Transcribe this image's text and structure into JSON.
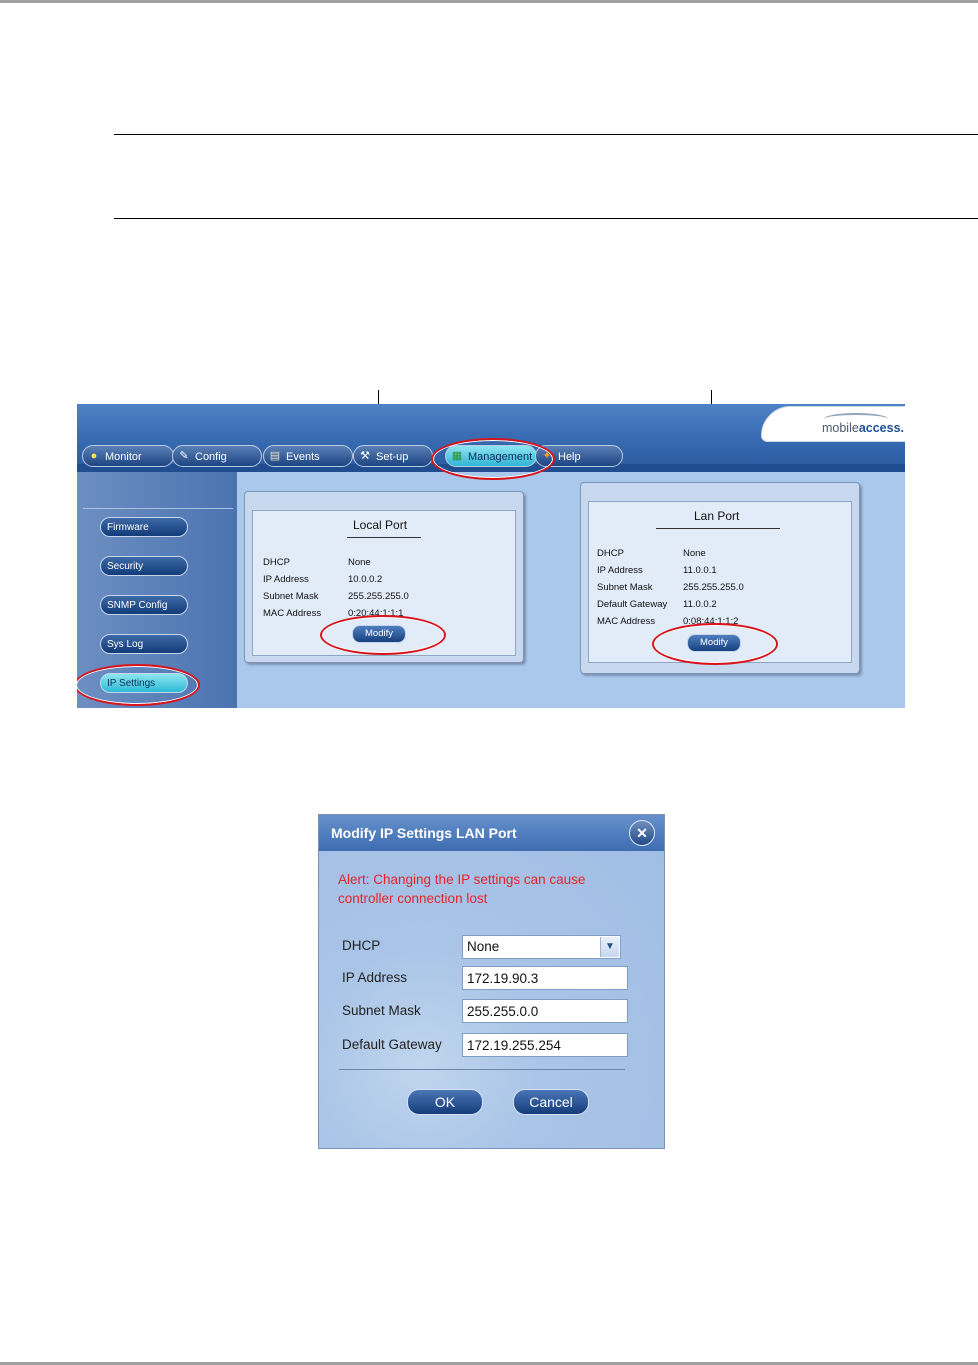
{
  "nav": {
    "tabs": [
      {
        "label": "Monitor",
        "icon": "monitor-icon"
      },
      {
        "label": "Config",
        "icon": "wrench-icon"
      },
      {
        "label": "Events",
        "icon": "events-icon"
      },
      {
        "label": "Set-up",
        "icon": "setup-icon"
      },
      {
        "label": "Management",
        "icon": "management-icon",
        "active": true
      },
      {
        "label": "Help",
        "icon": "help-icon"
      }
    ]
  },
  "logo": {
    "part1": "mobile",
    "part2": "access."
  },
  "sidebar": {
    "items": [
      {
        "label": "Firmware"
      },
      {
        "label": "Security"
      },
      {
        "label": "SNMP Config"
      },
      {
        "label": "Sys Log"
      },
      {
        "label": "IP Settings",
        "active": true
      }
    ]
  },
  "local_port": {
    "title": "Local Port",
    "rows": [
      {
        "key": "DHCP",
        "value": "None"
      },
      {
        "key": "IP Address",
        "value": "10.0.0.2"
      },
      {
        "key": "Subnet Mask",
        "value": "255.255.255.0"
      },
      {
        "key": "MAC Address",
        "value": "0:20:44:1:1:1"
      }
    ],
    "modify_label": "Modify"
  },
  "lan_port": {
    "title": "Lan Port",
    "rows": [
      {
        "key": "DHCP",
        "value": "None"
      },
      {
        "key": "IP Address",
        "value": "11.0.0.1"
      },
      {
        "key": "Subnet Mask",
        "value": "255.255.255.0"
      },
      {
        "key": "Default Gateway",
        "value": "11.0.0.2"
      },
      {
        "key": "MAC Address",
        "value": "0:08:44:1:1:2"
      }
    ],
    "modify_label": "Modify"
  },
  "dialog": {
    "title": "Modify IP Settings LAN Port",
    "close_symbol": "✕",
    "alert": "Alert: Changing the IP settings can cause controller connection lost",
    "dhcp_label": "DHCP",
    "dhcp_value": "None",
    "ip_label": "IP Address",
    "ip_value": "172.19.90.3",
    "mask_label": "Subnet Mask",
    "mask_value": "255.255.0.0",
    "gateway_label": "Default Gateway",
    "gateway_value": "172.19.255.254",
    "ok_label": "OK",
    "cancel_label": "Cancel"
  },
  "colors": {
    "accent": "#2a5aa0",
    "highlight": "#d8141a",
    "alert": "#e8232a"
  }
}
